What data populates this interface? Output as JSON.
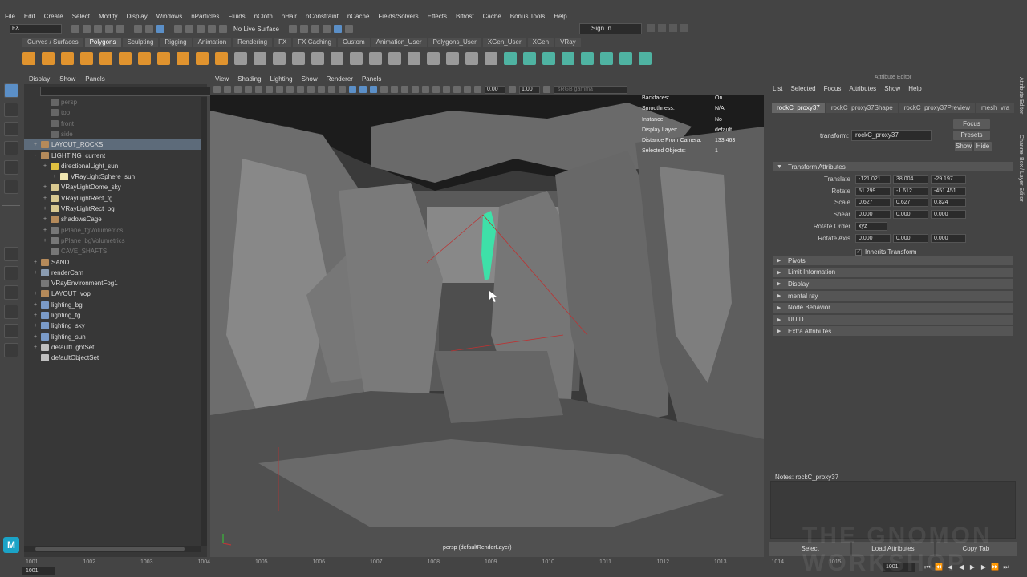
{
  "menubar": [
    "File",
    "Edit",
    "Create",
    "Select",
    "Modify",
    "Display",
    "Windows",
    "nParticles",
    "Fluids",
    "nCloth",
    "nHair",
    "nConstraint",
    "nCache",
    "Fields/Solvers",
    "Effects",
    "Bifrost",
    "Cache",
    "Bonus Tools",
    "Help"
  ],
  "status": {
    "mode": "FX",
    "live_surface": "No Live Surface",
    "signin": "Sign In"
  },
  "shelf_tabs": [
    "Curves / Surfaces",
    "Polygons",
    "Sculpting",
    "Rigging",
    "Animation",
    "Rendering",
    "FX",
    "FX Caching",
    "Custom",
    "Animation_User",
    "Polygons_User",
    "XGen_User",
    "XGen",
    "VRay"
  ],
  "outliner": {
    "menu": [
      "Display",
      "Show",
      "Panels"
    ],
    "items": [
      {
        "label": "persp",
        "dim": true,
        "indent": 1,
        "icon": "#666"
      },
      {
        "label": "top",
        "dim": true,
        "indent": 1,
        "icon": "#666"
      },
      {
        "label": "front",
        "dim": true,
        "indent": 1,
        "icon": "#666"
      },
      {
        "label": "side",
        "dim": true,
        "indent": 1,
        "icon": "#666"
      },
      {
        "label": "LAYOUT_ROCKS",
        "dim": false,
        "indent": 0,
        "icon": "#b58a5a",
        "selected": true,
        "expand": "+"
      },
      {
        "label": "LIGHTING_current",
        "dim": false,
        "indent": 0,
        "icon": "#b58a5a",
        "expand": "-"
      },
      {
        "label": "directionalLight_sun",
        "dim": false,
        "indent": 1,
        "icon": "#e0c040",
        "expand": "+"
      },
      {
        "label": "VRayLightSphere_sun",
        "dim": false,
        "indent": 2,
        "icon": "#f0e6b0",
        "expand": "+"
      },
      {
        "label": "VRayLightDome_sky",
        "dim": false,
        "indent": 1,
        "icon": "#d8c890",
        "expand": "+"
      },
      {
        "label": "VRayLightRect_fg",
        "dim": false,
        "indent": 1,
        "icon": "#d8c890",
        "expand": "+"
      },
      {
        "label": "VRayLightRect_bg",
        "dim": false,
        "indent": 1,
        "icon": "#d8c890",
        "expand": "+"
      },
      {
        "label": "shadowsCage",
        "dim": false,
        "indent": 1,
        "icon": "#b58a5a",
        "expand": "+"
      },
      {
        "label": "pPlane_fgVolumetrics",
        "dim": true,
        "indent": 1,
        "icon": "#777",
        "expand": "+"
      },
      {
        "label": "pPlane_bgVolumetrics",
        "dim": true,
        "indent": 1,
        "icon": "#777",
        "expand": "+"
      },
      {
        "label": "CAVE_SHAFTS",
        "dim": true,
        "indent": 1,
        "icon": "#777"
      },
      {
        "label": "SAND",
        "dim": false,
        "indent": 0,
        "icon": "#b58a5a",
        "expand": "+"
      },
      {
        "label": "renderCam",
        "dim": false,
        "indent": 0,
        "icon": "#8a9bb0",
        "expand": "+"
      },
      {
        "label": "VRayEnvironmentFog1",
        "dim": false,
        "indent": 0,
        "icon": "#777"
      },
      {
        "label": "LAYOUT_vop",
        "dim": false,
        "indent": 0,
        "icon": "#b58a5a",
        "expand": "+"
      },
      {
        "label": "lighting_bg",
        "dim": false,
        "indent": 0,
        "icon": "#7a9ac7",
        "expand": "+"
      },
      {
        "label": "lighting_fg",
        "dim": false,
        "indent": 0,
        "icon": "#7a9ac7",
        "expand": "+"
      },
      {
        "label": "lighting_sky",
        "dim": false,
        "indent": 0,
        "icon": "#7a9ac7",
        "expand": "+"
      },
      {
        "label": "lighting_sun",
        "dim": false,
        "indent": 0,
        "icon": "#7a9ac7",
        "expand": "+"
      },
      {
        "label": "defaultLightSet",
        "dim": false,
        "indent": 0,
        "icon": "#c0c0c0",
        "expand": "+"
      },
      {
        "label": "defaultObjectSet",
        "dim": false,
        "indent": 0,
        "icon": "#c0c0c0"
      }
    ]
  },
  "viewport": {
    "menu": [
      "View",
      "Shading",
      "Lighting",
      "Show",
      "Renderer",
      "Panels"
    ],
    "near": "0.00",
    "far": "1.00",
    "gamma": "sRGB gamma",
    "hud": [
      {
        "k": "Backfaces:",
        "v": "On"
      },
      {
        "k": "Smoothness:",
        "v": "N/A"
      },
      {
        "k": "Instance:",
        "v": "No"
      },
      {
        "k": "Display Layer:",
        "v": "default"
      },
      {
        "k": "Distance From Camera:",
        "v": "133.463"
      },
      {
        "k": "Selected Objects:",
        "v": "1"
      }
    ],
    "camera": "persp (defaultRenderLayer)"
  },
  "attr": {
    "title": "Attribute Editor",
    "menu": [
      "List",
      "Selected",
      "Focus",
      "Attributes",
      "Show",
      "Help"
    ],
    "tabs": [
      "rockC_proxy37",
      "rockC_proxy37Shape",
      "rockC_proxy37Preview",
      "mesh_vra"
    ],
    "transform_label": "transform:",
    "transform_value": "rockC_proxy37",
    "focus": "Focus",
    "presets": "Presets",
    "show": "Show",
    "hide": "Hide",
    "section_transform": "Transform Attributes",
    "rows": [
      {
        "label": "Translate",
        "v": [
          "-121.021",
          "38.004",
          "-29.197"
        ]
      },
      {
        "label": "Rotate",
        "v": [
          "51.299",
          "-1.612",
          "-451.451"
        ]
      },
      {
        "label": "Scale",
        "v": [
          "0.627",
          "0.627",
          "0.824"
        ]
      },
      {
        "label": "Shear",
        "v": [
          "0.000",
          "0.000",
          "0.000"
        ]
      }
    ],
    "rotate_order_label": "Rotate Order",
    "rotate_order": "xyz",
    "rotate_axis_label": "Rotate Axis",
    "rotate_axis": [
      "0.000",
      "0.000",
      "0.000"
    ],
    "inherits": "Inherits Transform",
    "sections": [
      "Pivots",
      "Limit Information",
      "Display",
      "mental ray",
      "Node Behavior",
      "UUID",
      "Extra Attributes"
    ],
    "notes": "Notes:  rockC_proxy37",
    "buttons": [
      "Select",
      "Load Attributes",
      "Copy Tab"
    ],
    "side_tabs": [
      "Attribute Editor",
      "Channel Box / Layer Editor"
    ]
  },
  "timeline": {
    "ticks": [
      "1001",
      "1002",
      "1003",
      "1004",
      "1005",
      "1006",
      "1007",
      "1008",
      "1009",
      "1010",
      "1011",
      "1012",
      "1013",
      "1014",
      "1015"
    ],
    "current": "1001",
    "current_right": "1001",
    "controls": [
      "⏮",
      "⏪",
      "◀",
      "◀",
      "▶",
      "▶",
      "⏩",
      "⏭"
    ]
  },
  "watermark": "THE GNOMON WORKSHOP",
  "logo": "M"
}
